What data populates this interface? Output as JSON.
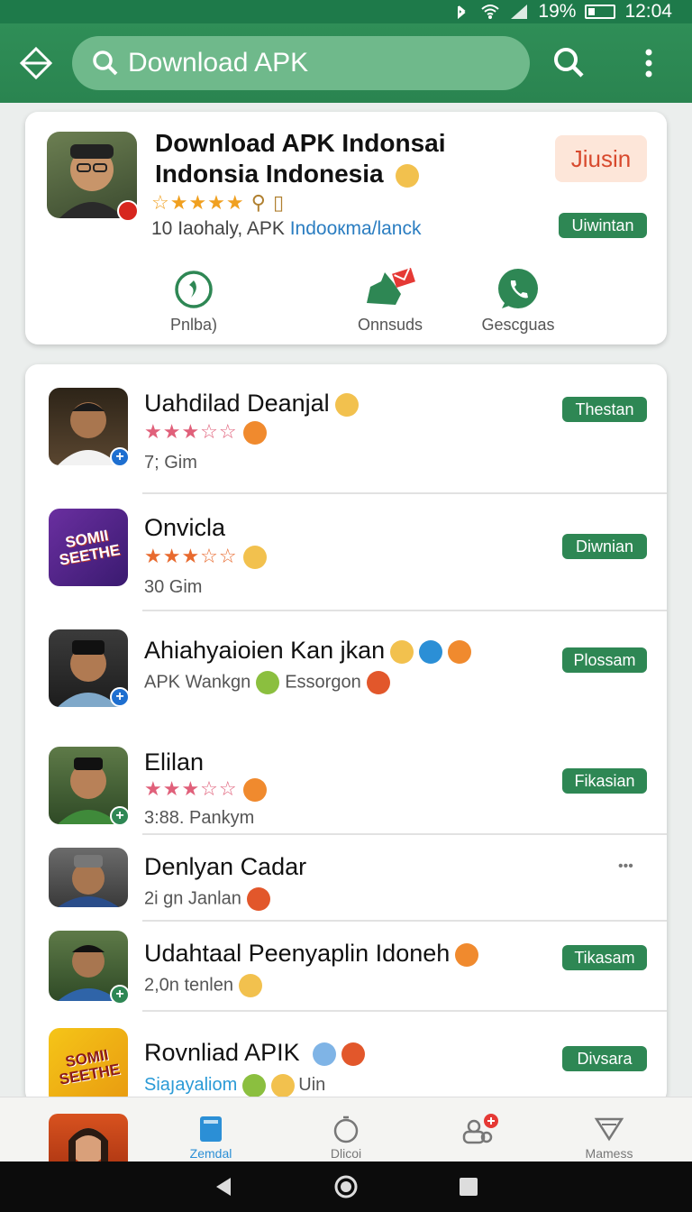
{
  "status_bar": {
    "battery": "19%",
    "time": "12:04"
  },
  "app_bar": {
    "search_text": "Download APK"
  },
  "featured": {
    "title": "Download APK Indonsai Indonsia Indonesia",
    "stars": "☆★★★★",
    "meta_prefix": "10 Iaohaly, APK ",
    "meta_link": "Indooкma/lanck",
    "button_label": "Jiusin",
    "tag_label": "Uiwintan",
    "actions": [
      {
        "label": "Pnlba)"
      },
      {
        "label": "Onnsuds"
      },
      {
        "label": "Gescguas"
      }
    ]
  },
  "apps": [
    {
      "name": "Uahdilad Deanjal",
      "stars": "★★★☆☆",
      "sub": "7; Gim",
      "tag": "Thestan"
    },
    {
      "name": "Onvicla",
      "stars": "★★★☆☆",
      "sub": "30 Gim",
      "tag": "Diwnian"
    },
    {
      "name": "Ahiahyaioien Kan jkan",
      "sub": "APK Wankgn",
      "sub2": "Essorgon",
      "tag": "Plossam"
    },
    {
      "name": "Elilan",
      "stars": "★★★☆☆",
      "sub": "3:88. Pankym",
      "tag": "Fikasian"
    },
    {
      "name": "Denlyan Cadar",
      "sub": "2i gn  Janlan",
      "more": "•••"
    },
    {
      "name": "Udahtaal Peenyaplin Idoneh",
      "sub": "2,0n  tenlen",
      "tag": "Tikasam"
    },
    {
      "name": "Rovnliad APIK",
      "sub": "Siaյayaliom",
      "sub2": "Uin",
      "tag": "Divsara"
    }
  ],
  "thumb_texts": {
    "game_logo": "SOMII SEETHE"
  },
  "bottom_nav": [
    {
      "label": "Zemdal"
    },
    {
      "label": "Dlicoi"
    },
    {
      "label": ""
    },
    {
      "label": "Mamess"
    }
  ],
  "colors": {
    "primary": "#2e8754",
    "accent_red": "#d84a2e",
    "link": "#2a7dc1",
    "star": "#f0a020",
    "star_pink": "#e0607a"
  }
}
